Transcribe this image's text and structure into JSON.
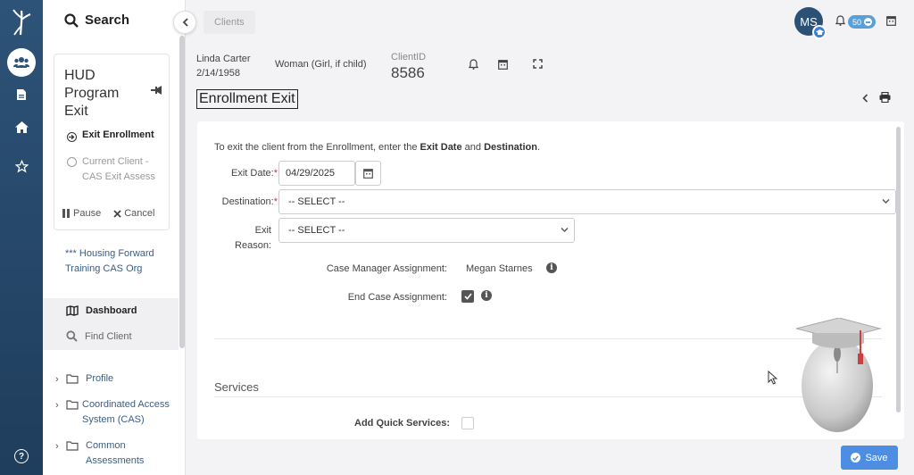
{
  "rail": {
    "icons": [
      "logo-figure-icon",
      "people-icon",
      "document-icon",
      "home-icon",
      "star-icon",
      "help-icon"
    ],
    "help_glyph": "?"
  },
  "sidebar": {
    "search_label": "Search",
    "workflow": {
      "title": "HUD Program Exit",
      "steps": [
        {
          "label": "Exit Enrollment",
          "active": true
        },
        {
          "label": "Current Client - CAS Exit Assess",
          "active": false
        }
      ],
      "pause_label": "Pause",
      "cancel_label": "Cancel"
    },
    "org_name": "*** Housing Forward Training CAS Org",
    "nav": [
      {
        "label": "Dashboard",
        "icon": "map-icon"
      },
      {
        "label": "Find Client",
        "icon": "search-icon"
      }
    ],
    "tree": [
      {
        "label": "Profile"
      },
      {
        "label": "Coordinated Access System (CAS)"
      },
      {
        "label": "Common Assessments"
      }
    ]
  },
  "header": {
    "breadcrumb": "Clients",
    "avatar_initials": "MS",
    "notification_count": "50"
  },
  "client": {
    "name": "Linda Carter",
    "dob": "2/14/1958",
    "gender": "Woman (Girl, if child)",
    "client_id_label": "ClientID",
    "client_id": "8586"
  },
  "page": {
    "title": "Enrollment Exit"
  },
  "form": {
    "intro_prefix": "To exit the client from the Enrollment, enter the ",
    "intro_b1": "Exit Date",
    "intro_mid": " and ",
    "intro_b2": "Destination",
    "intro_suffix": ".",
    "exit_date_label": "Exit Date:",
    "exit_date_value": "04/29/2025",
    "destination_label": "Destination:",
    "destination_value": "-- SELECT --",
    "exit_reason_label_1": "Exit",
    "exit_reason_label_2": "Reason:",
    "exit_reason_value": "-- SELECT --",
    "required_mark": "*",
    "case_manager_label": "Case Manager Assignment:",
    "case_manager_value": "Megan Starnes",
    "end_case_label": "End Case Assignment:",
    "end_case_checked": true,
    "info_glyph": "i",
    "services_heading": "Services",
    "quick_services_label": "Add Quick Services:",
    "quick_services_checked": false
  },
  "actions": {
    "save_label": "Save"
  },
  "colors": {
    "rail": "#2d5378",
    "link": "#3a5d86",
    "save": "#4d8ee3",
    "required": "#d0312d"
  }
}
